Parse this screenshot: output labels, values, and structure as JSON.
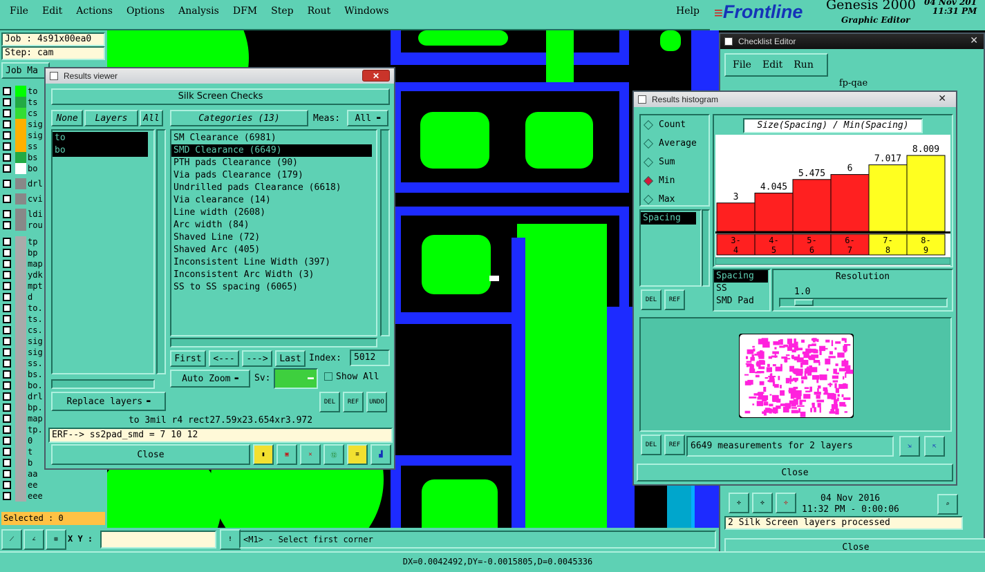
{
  "menubar": {
    "items": [
      "File",
      "Edit",
      "Actions",
      "Options",
      "Analysis",
      "DFM",
      "Step",
      "Rout",
      "Windows"
    ],
    "help": "Help"
  },
  "brand": {
    "logo": "Frontline",
    "product": "Genesis 2000",
    "subtitle": "Graphic Editor",
    "date": "04 Nov 201",
    "time": "11:31 PM"
  },
  "job": {
    "job_label": "Job : 4s91x00ea0",
    "step_label": "Step: cam",
    "job_manager": "Job Ma"
  },
  "layers": [
    {
      "name": "to",
      "color": "#00ff00"
    },
    {
      "name": "ts",
      "color": "#22aa44"
    },
    {
      "name": "cs",
      "color": "#33dd33"
    },
    {
      "name": "sig",
      "color": "#ffb000"
    },
    {
      "name": "sig",
      "color": "#ffb000"
    },
    {
      "name": "ss",
      "color": "#ffb000"
    },
    {
      "name": "bs",
      "color": "#22aa44"
    },
    {
      "name": "bo",
      "color": "#ffffff"
    },
    {
      "name": "drl",
      "color": "#888888"
    },
    {
      "name": "cvi",
      "color": "#888888"
    },
    {
      "name": "ldi",
      "color": "#888888"
    },
    {
      "name": "rou",
      "color": "#888888"
    },
    {
      "name": "tp",
      "color": "#aaaaaa"
    },
    {
      "name": "bp",
      "color": "#aaaaaa"
    },
    {
      "name": "map",
      "color": "#aaaaaa"
    },
    {
      "name": "ydk",
      "color": "#aaaaaa"
    },
    {
      "name": "mpt",
      "color": "#aaaaaa"
    },
    {
      "name": "d",
      "color": "#aaaaaa"
    },
    {
      "name": "to.",
      "color": "#aaaaaa"
    },
    {
      "name": "ts.",
      "color": "#aaaaaa"
    },
    {
      "name": "cs.",
      "color": "#aaaaaa"
    },
    {
      "name": "sig",
      "color": "#aaaaaa"
    },
    {
      "name": "sig",
      "color": "#aaaaaa"
    },
    {
      "name": "ss.",
      "color": "#aaaaaa"
    },
    {
      "name": "bs.",
      "color": "#aaaaaa"
    },
    {
      "name": "bo.",
      "color": "#aaaaaa"
    },
    {
      "name": "drl",
      "color": "#aaaaaa"
    },
    {
      "name": "bp.",
      "color": "#aaaaaa"
    },
    {
      "name": "map",
      "color": "#aaaaaa"
    },
    {
      "name": "tp.",
      "color": "#aaaaaa"
    },
    {
      "name": "0",
      "color": "#aaaaaa"
    },
    {
      "name": "t",
      "color": "#aaaaaa"
    },
    {
      "name": "b",
      "color": "#aaaaaa"
    },
    {
      "name": "aa",
      "color": "#aaaaaa"
    },
    {
      "name": "ee",
      "color": "#aaaaaa"
    },
    {
      "name": "eee",
      "color": "#aaaaaa"
    }
  ],
  "selected": "Selected : 0",
  "results_viewer": {
    "title": "Results viewer",
    "header": "Silk Screen Checks",
    "none_btn": "None",
    "layers_btn": "Layers",
    "all_btn": "All",
    "layer_list": [
      "to",
      "bo"
    ],
    "categories_btn": "Categories (13)",
    "meas_label": "Meas:",
    "meas_value": "All",
    "categories": [
      "SM Clearance (6981)",
      "SMD Clearance (6649)",
      "PTH pads Clearance (90)",
      "Via pads Clearance (179)",
      "Undrilled pads Clearance (6618)",
      "Via clearance (14)",
      "Line width (2608)",
      "Arc width (84)",
      "Shaved Line (72)",
      "Shaved Arc (405)",
      "Inconsistent Line Width (397)",
      "Inconsistent Arc Width (3)",
      "SS to SS spacing (6065)"
    ],
    "first": "First",
    "prev": "<---",
    "next": "--->",
    "last": "Last",
    "index_label": "Index:",
    "index_value": "5012",
    "zoom": "Auto Zoom",
    "sv_label": "Sv:",
    "show_all": "Show All",
    "replace_layers": "Replace layers",
    "del": "DEL",
    "ref": "REF",
    "undo": "UNDO",
    "info": "to 3mil   r4   rect27.59x23.654xr3.972",
    "erf": "ERF--> ss2pad_smd = 7 10 12",
    "close": "Close"
  },
  "histogram": {
    "title": "Results histogram",
    "modes": [
      "Count",
      "Average",
      "Sum",
      "Min",
      "Max"
    ],
    "active_mode": "Min",
    "chart_title": "Size(Spacing) / Min(Spacing)",
    "measure_list": [
      "Spacing"
    ],
    "sub_list": [
      "Spacing",
      "SS",
      "SMD Pad"
    ],
    "resolution_label": "Resolution",
    "resolution_value": "1.0",
    "measurements": "6649 measurements for 2 layers",
    "close": "Close",
    "del": "DEL",
    "ref": "REF",
    "chart_data": {
      "type": "bar",
      "categories": [
        "3-4",
        "4-5",
        "5-6",
        "6-7",
        "7-8",
        "8-9"
      ],
      "values": [
        3,
        4.045,
        5.475,
        6,
        7.017,
        8.009
      ],
      "colors": [
        "#ff2020",
        "#ff2020",
        "#ff2020",
        "#ff2020",
        "#ffff20",
        "#ffff20"
      ],
      "title": "Size(Spacing) / Min(Spacing)",
      "xlabel": "",
      "ylabel": ""
    }
  },
  "checklist": {
    "title": "Checklist Editor",
    "menu": [
      "File",
      "Edit",
      "Run"
    ],
    "name": "fp-qae",
    "date": "04 Nov 2016",
    "time": "11:32 PM - 0:00:06",
    "status": "2 Silk Screen layers processed",
    "close": "Close"
  },
  "bottom": {
    "xy_label": "X Y :",
    "prompt": "<M1> - Select first corner",
    "coords": "DX=0.0042492,DY=-0.0015805,D=0.0045336"
  }
}
